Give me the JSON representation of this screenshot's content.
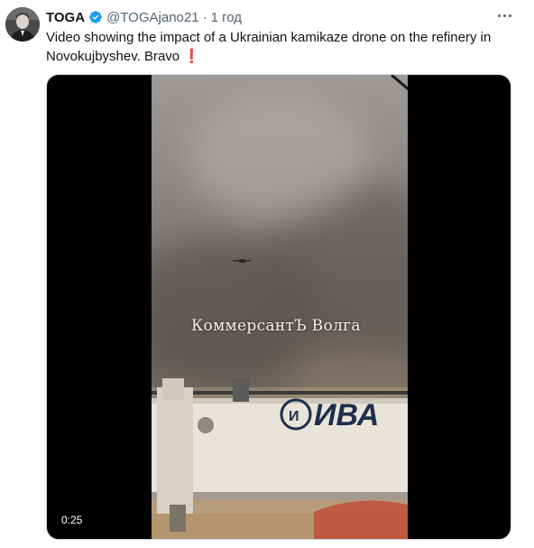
{
  "tweet": {
    "display_name": "TOGA",
    "handle": "@TOGAjano21",
    "separator": "·",
    "time": "1 год",
    "text": "Video showing the impact of a Ukrainian kamikaze drone on the refinery in Novokujbyshev. Bravo",
    "text_emoji": "❗",
    "verified": true
  },
  "media": {
    "watermark": "КоммерсантЪ Волга",
    "crane_text": "ИВА",
    "duration": "0:25"
  },
  "icons": {
    "avatar": "avatar-photo",
    "verified": "verified-badge-icon",
    "more": "more-icon"
  },
  "colors": {
    "verified": "#1d9bf0",
    "secondary_text": "#536471",
    "crane_text": "#1c2e4a"
  }
}
